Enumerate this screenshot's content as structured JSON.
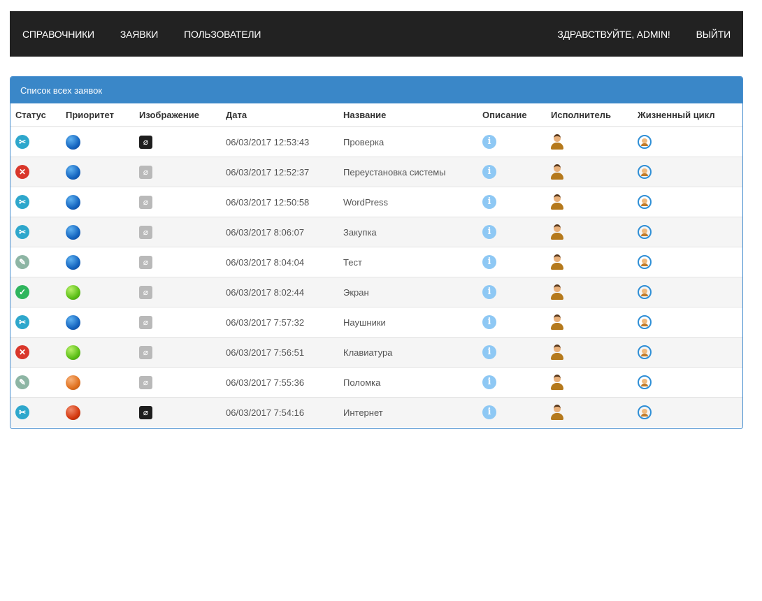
{
  "nav": {
    "left": [
      "Справочники",
      "Заявки",
      "Пользователи"
    ],
    "greeting": "Здравствуйте, admin!",
    "logout": "Выйти"
  },
  "panel": {
    "title": "Список всех заявок"
  },
  "table": {
    "columns": [
      "Статус",
      "Приоритет",
      "Изображение",
      "Дата",
      "Название",
      "Описание",
      "Исполнитель",
      "Жизненный цикл"
    ],
    "rows": [
      {
        "status": "in-progress-icon",
        "priority": "blue",
        "image": true,
        "date": "06/03/2017 12:53:43",
        "name": "Проверка"
      },
      {
        "status": "cancelled-icon",
        "priority": "blue",
        "image": false,
        "date": "06/03/2017 12:52:37",
        "name": "Переустановка системы"
      },
      {
        "status": "in-progress-icon",
        "priority": "blue",
        "image": false,
        "date": "06/03/2017 12:50:58",
        "name": "WordPress"
      },
      {
        "status": "in-progress-icon",
        "priority": "blue",
        "image": false,
        "date": "06/03/2017 8:06:07",
        "name": "Закупка"
      },
      {
        "status": "edit-icon",
        "priority": "blue",
        "image": false,
        "date": "06/03/2017 8:04:04",
        "name": "Тест"
      },
      {
        "status": "done-icon",
        "priority": "green",
        "image": false,
        "date": "06/03/2017 8:02:44",
        "name": "Экран"
      },
      {
        "status": "in-progress-icon",
        "priority": "blue",
        "image": false,
        "date": "06/03/2017 7:57:32",
        "name": "Наушники"
      },
      {
        "status": "cancelled-icon",
        "priority": "green",
        "image": false,
        "date": "06/03/2017 7:56:51",
        "name": "Клавиатура"
      },
      {
        "status": "edit-icon",
        "priority": "orange",
        "image": false,
        "date": "06/03/2017 7:55:36",
        "name": "Поломка"
      },
      {
        "status": "in-progress-icon",
        "priority": "red",
        "image": true,
        "date": "06/03/2017 7:54:16",
        "name": "Интернет"
      }
    ]
  }
}
